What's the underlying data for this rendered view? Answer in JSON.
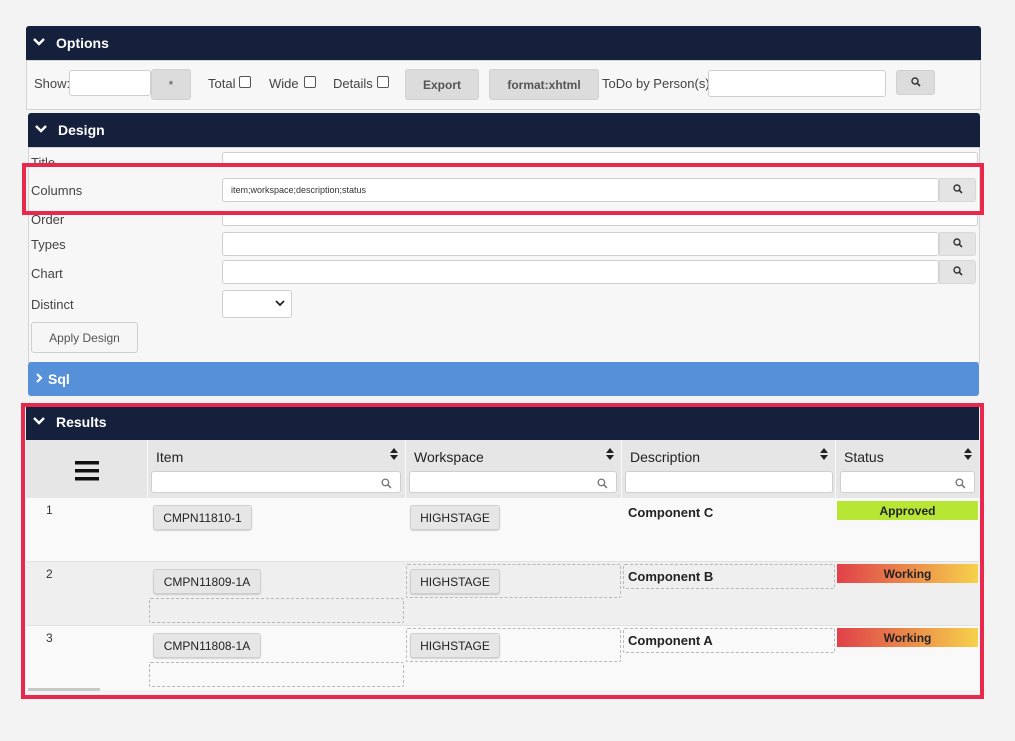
{
  "options": {
    "header": "Options",
    "show_label": "Show:",
    "show_value": "",
    "star_button": "*",
    "total_label": "Total",
    "wide_label": "Wide",
    "details_label": "Details",
    "export_button": "Export",
    "format_button": "format:xhtml",
    "todo_label": "ToDo by Person(s)",
    "todo_value": ""
  },
  "design": {
    "header": "Design",
    "title_label": "Title",
    "columns_label": "Columns",
    "columns_value": "item;workspace;description;status",
    "order_label": "Order",
    "types_label": "Types",
    "chart_label": "Chart",
    "distinct_label": "Distinct",
    "distinct_value": "",
    "apply_button": "Apply Design"
  },
  "sql": {
    "header": "Sql"
  },
  "results": {
    "header": "Results",
    "columns": [
      "Item",
      "Workspace",
      "Description",
      "Status"
    ],
    "rows": [
      {
        "num": "1",
        "item": "CMPN11810-1",
        "workspace": "HIGHSTAGE",
        "description": "Component C",
        "status": "Approved"
      },
      {
        "num": "2",
        "item": "CMPN11809-1A",
        "workspace": "HIGHSTAGE",
        "description": "Component B",
        "status": "Working"
      },
      {
        "num": "3",
        "item": "CMPN11808-1A",
        "workspace": "HIGHSTAGE",
        "description": "Component A",
        "status": "Working"
      }
    ]
  },
  "colors": {
    "header_bar": "#15203d",
    "sql_bar": "#5590d9",
    "highlight": "#e8284c",
    "approved": "#b7e634",
    "working_start": "#e0404a",
    "working_end": "#f6d24a"
  }
}
